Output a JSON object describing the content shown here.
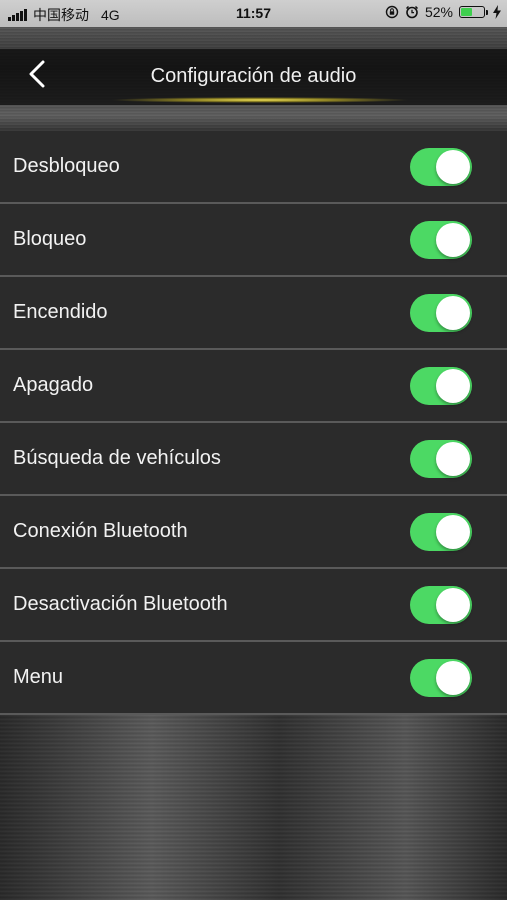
{
  "status_bar": {
    "carrier": "中国移动",
    "network": "4G",
    "time": "11:57",
    "battery_text": "52%",
    "battery_level": 0.52,
    "battery_color": "#3fcf4f",
    "icons": [
      "signal-icon",
      "rotation-lock-icon",
      "alarm-icon",
      "battery-icon",
      "charging-icon"
    ]
  },
  "header": {
    "title": "Configuración de audio",
    "back_icon": "chevron-left-icon"
  },
  "settings": [
    {
      "label": "Desbloqueo",
      "enabled": true
    },
    {
      "label": "Bloqueo",
      "enabled": true
    },
    {
      "label": "Encendido",
      "enabled": true
    },
    {
      "label": "Apagado",
      "enabled": true
    },
    {
      "label": "Búsqueda de vehículos",
      "enabled": true
    },
    {
      "label": "Conexión Bluetooth",
      "enabled": true
    },
    {
      "label": "Desactivación Bluetooth",
      "enabled": true
    },
    {
      "label": "Menu",
      "enabled": true
    }
  ],
  "colors": {
    "toggle_on": "#4cd964",
    "header_glow": "#f2e35a",
    "background": "#2b2b2b"
  }
}
